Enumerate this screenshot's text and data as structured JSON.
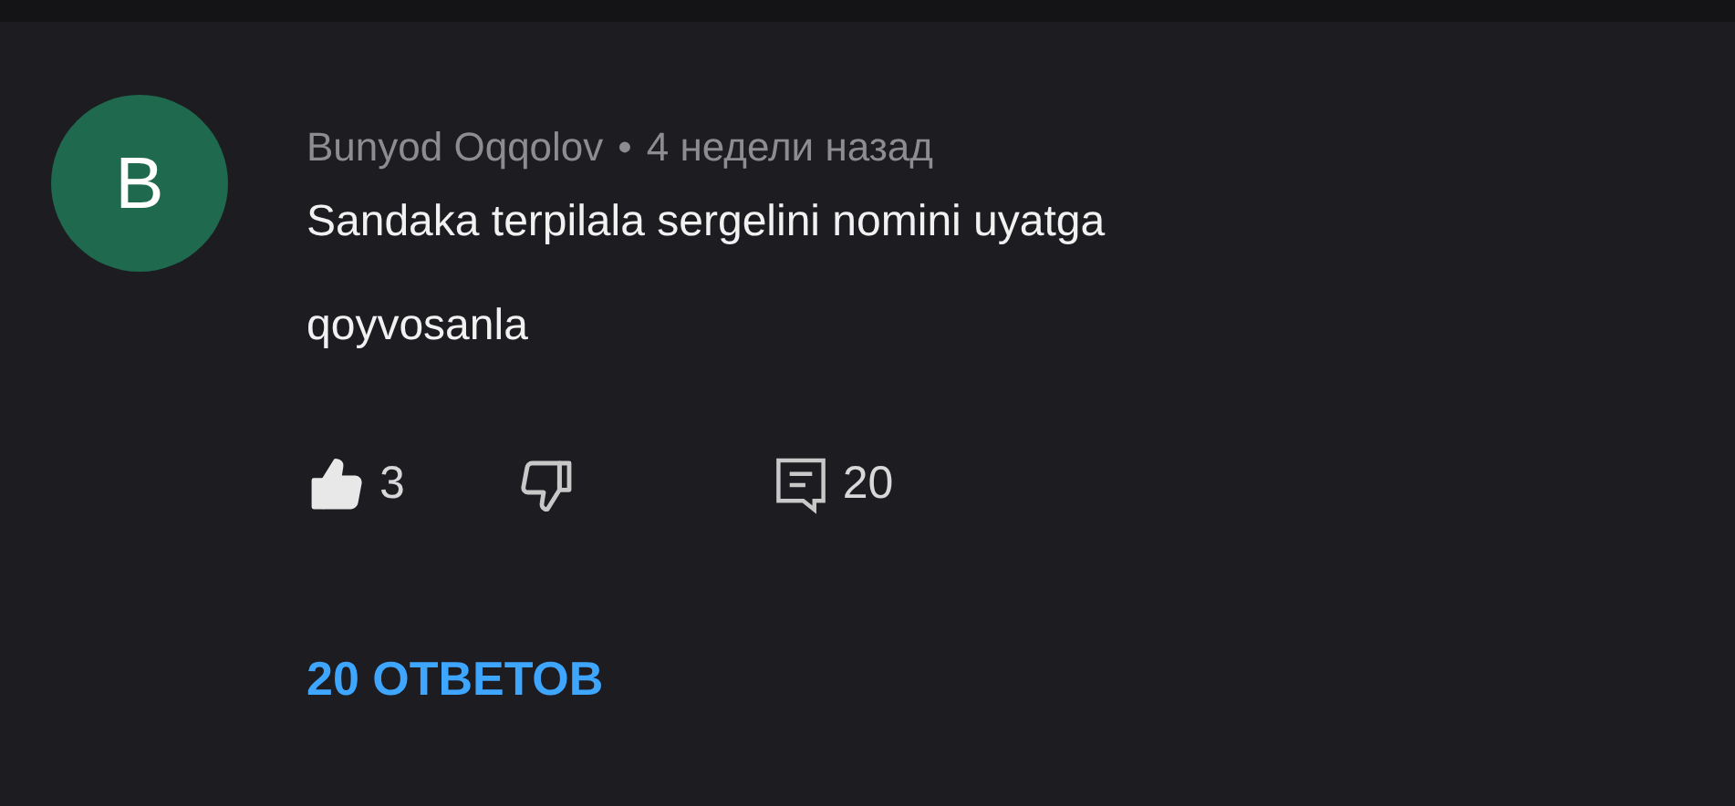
{
  "comment": {
    "avatar_letter": "B",
    "author": "Bunyod Oqqolov",
    "separator": "•",
    "time": "4 недели назад",
    "text": "Sandaka terpilala sergelini nomini uyatga qoyvosanla",
    "liked": true,
    "disliked": false,
    "like_count": "3",
    "reply_count": "20",
    "replies_link": "20 ОТВЕТОВ"
  }
}
